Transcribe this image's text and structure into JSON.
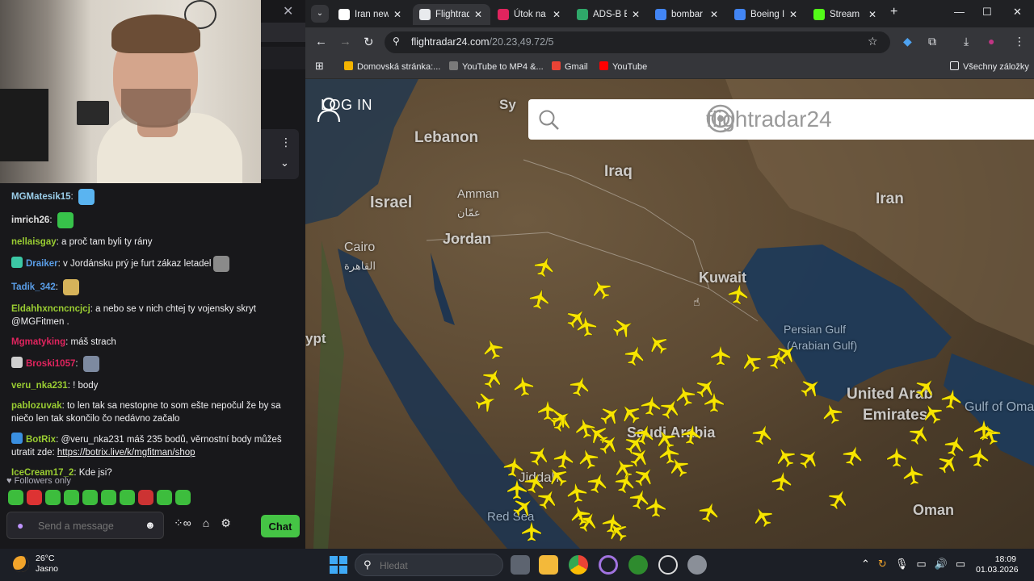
{
  "chat": {
    "messages": [
      {
        "user": "MGMatesik15",
        "color": "#9acde8",
        "text": "",
        "badge": null,
        "emote": "#5ab4f0"
      },
      {
        "user": "imrich26",
        "color": "#e0e0e0",
        "text": "",
        "badge": null,
        "emote": "#37c24a"
      },
      {
        "user": "nellaisgay",
        "color": "#9acd32",
        "text": "a proč tam byli ty rány",
        "badge": null,
        "emote": null
      },
      {
        "user": "Draiker",
        "color": "#5a9ee8",
        "text": "v Jordánsku prý je furt zákaz letadel",
        "badge": "#3cc8a5",
        "emote": "#8a8a8a"
      },
      {
        "user": "Tadik_342",
        "color": "#5a9ee8",
        "text": "",
        "badge": null,
        "emote": "#d6b35a"
      },
      {
        "user": "Eldahhxncncncjcj",
        "color": "#9acd32",
        "text": "a nebo se v nich chtej ty vojensky skryt @MGFitmen .",
        "badge": null,
        "emote": null
      },
      {
        "user": "Mgmatyking",
        "color": "#e0245e",
        "text": "máš strach",
        "badge": null,
        "emote": null
      },
      {
        "user": "Broski1057",
        "color": "#e0245e",
        "text": "",
        "badge": "#cfcfcf",
        "emote": "#7d8aa0"
      },
      {
        "user": "veru_nka231",
        "color": "#9acd32",
        "text": "! body",
        "badge": null,
        "emote": null
      },
      {
        "user": "pablozuvak",
        "color": "#9acd32",
        "text": "to len tak sa nestopne to som ešte nepočul že by sa niečo len tak skončilo čo nedávno začalo",
        "badge": null,
        "emote": null
      },
      {
        "user": "BotRix",
        "color": "#9acd32",
        "text": "@veru_nka231 máš 235 bodů, věrnostní body můžeš utratit zde: ",
        "badge": "#3a8fe0",
        "emote": null,
        "link": "https://botrix.live/k/mgfitman/shop"
      },
      {
        "user": "IceCream17_2",
        "color": "#9acd32",
        "text": "Kde jsi?",
        "badge": null,
        "emote": null
      }
    ],
    "followers_only": "Followers only",
    "input_placeholder": "Send a message",
    "chat_button": "Chat"
  },
  "browser": {
    "tabs": [
      {
        "label": "Iran new",
        "fav": "#ffffff",
        "active": false
      },
      {
        "label": "Flightrad",
        "fav": "#e8eaed",
        "active": true
      },
      {
        "label": "Útok na",
        "fav": "#e0245e",
        "active": false
      },
      {
        "label": "ADS-B E",
        "fav": "#2fa86a",
        "active": false
      },
      {
        "label": "bombar",
        "fav": "#4285f4",
        "active": false
      },
      {
        "label": "Boeing I",
        "fav": "#4285f4",
        "active": false
      },
      {
        "label": "Stream",
        "fav": "#53fc18",
        "active": false
      }
    ],
    "url_host": "flightradar24.com",
    "url_path": "/20.23,49.72/5",
    "bookmarks": [
      {
        "label": "Domovská stránka:...",
        "color": "#f4b400"
      },
      {
        "label": "YouTube to MP4 &...",
        "color": "#7a7a7a"
      },
      {
        "label": "Gmail",
        "color": "#ea4335"
      },
      {
        "label": "YouTube",
        "color": "#ff0000"
      }
    ],
    "all_bookmarks": "Všechny záložky"
  },
  "map": {
    "login_label": "LOG IN",
    "logo_text": "flightradar24",
    "labels": [
      {
        "text": "Lebanon",
        "kind": "country"
      },
      {
        "text": "Iraq",
        "kind": "country"
      },
      {
        "text": "Israel",
        "kind": "country"
      },
      {
        "text": "Amman",
        "kind": "city"
      },
      {
        "text": "عمّان",
        "kind": "city"
      },
      {
        "text": "Iran",
        "kind": "country"
      },
      {
        "text": "Jordan",
        "kind": "country"
      },
      {
        "text": "Cairo",
        "kind": "city"
      },
      {
        "text": "القاهرة",
        "kind": "city"
      },
      {
        "text": "Kuwait",
        "kind": "country"
      },
      {
        "text": "Persian Gulf",
        "kind": "sea"
      },
      {
        "text": "(Arabian Gulf)",
        "kind": "sea"
      },
      {
        "text": "ypt",
        "kind": "country"
      },
      {
        "text": "United Arab",
        "kind": "country"
      },
      {
        "text": "Emirates",
        "kind": "country"
      },
      {
        "text": "Gulf of Oma",
        "kind": "sea"
      },
      {
        "text": "Saudi Arabia",
        "kind": "country"
      },
      {
        "text": "Jiddah",
        "kind": "city"
      },
      {
        "text": "Red Sea",
        "kind": "sea"
      },
      {
        "text": "Oman",
        "kind": "country"
      },
      {
        "text": "Sy",
        "kind": "country"
      }
    ],
    "plane_color": "#f7e400"
  },
  "taskbar": {
    "temp": "26°C",
    "weather": "Jasno",
    "search_placeholder": "Hledat",
    "time": "18:09",
    "date": "01.03.2026"
  }
}
